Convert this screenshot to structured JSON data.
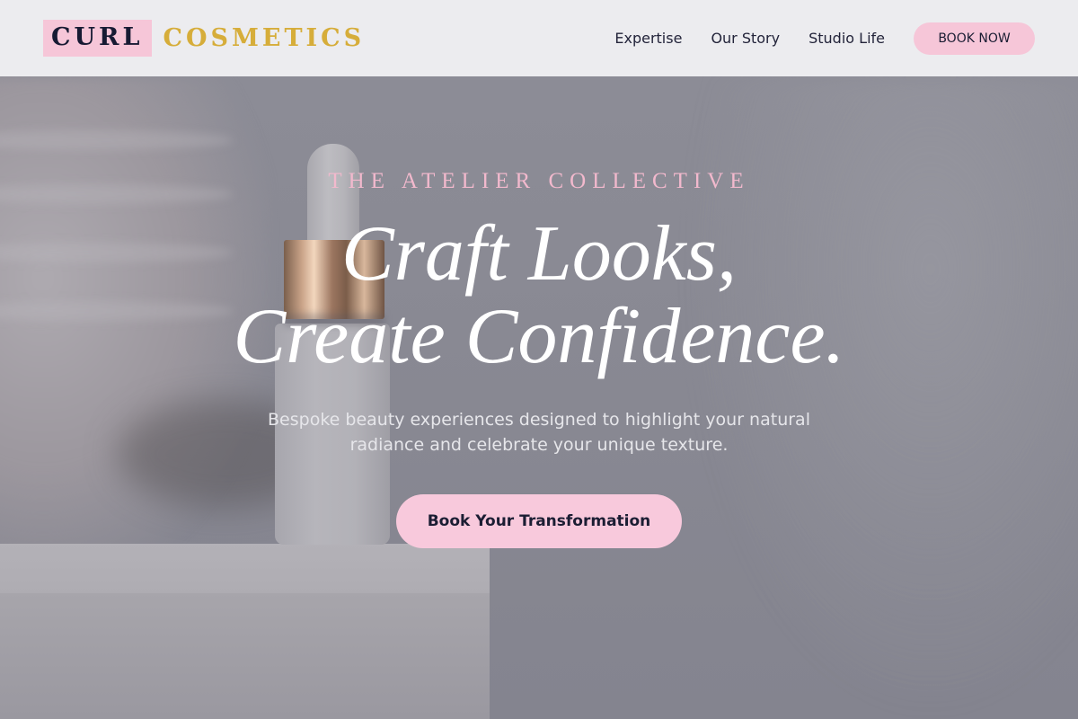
{
  "brand": {
    "name_part1": "CURL",
    "name_part2": "COSMETICS",
    "accent_pink": "#f6c6d8",
    "accent_gold": "#d6ad3a",
    "ink": "#171a33"
  },
  "nav": {
    "links": [
      {
        "label": "Expertise"
      },
      {
        "label": "Our Story"
      },
      {
        "label": "Studio Life"
      }
    ],
    "cta_label": "BOOK NOW"
  },
  "hero": {
    "eyebrow": "THE ATELIER COLLECTIVE",
    "headline_line1": "Craft Looks,",
    "headline_line2": "Create Confidence.",
    "subtitle": "Bespoke beauty experiences designed to highlight your natural radiance and celebrate your unique texture.",
    "cta_label": "Book Your Transformation",
    "background_image": "blurred-serum-dropper-bottle-on-marble"
  }
}
